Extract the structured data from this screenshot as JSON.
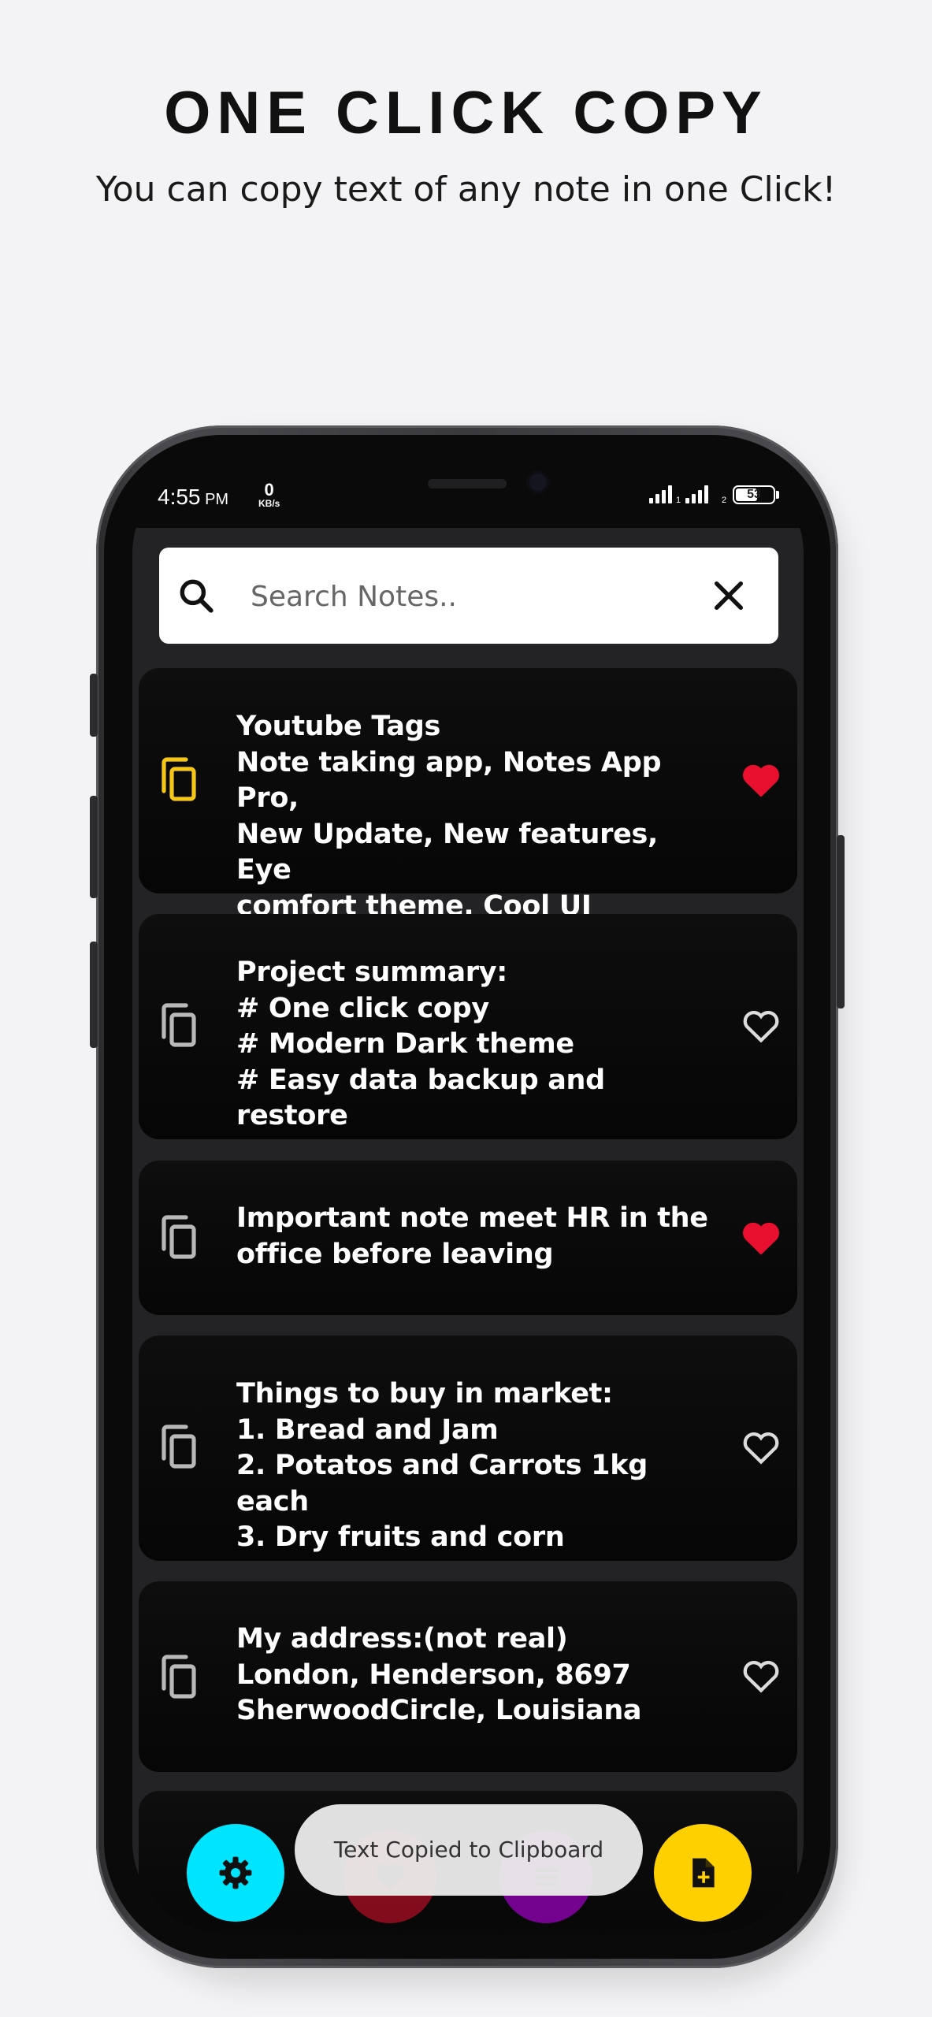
{
  "promo": {
    "title": "ONE CLICK COPY",
    "subtitle": "You can copy text of any note in one Click!"
  },
  "status_bar": {
    "time": "4:55",
    "ampm": "PM",
    "net_speed": "0",
    "net_unit": "KB/s",
    "sim1": "1",
    "sim2": "2",
    "battery": "53"
  },
  "search": {
    "placeholder": "Search Notes..",
    "value": ""
  },
  "notes": [
    {
      "text": "Youtube Tags\nNote taking app, Notes App Pro,\nNew Update, New features, Eye\ncomfort theme, Cool UI",
      "favorite": true,
      "copied": true
    },
    {
      "text": "Project summary:\n# One click copy\n# Modern Dark theme\n# Easy data backup and restore",
      "favorite": false,
      "copied": false
    },
    {
      "text": "Important note meet HR in the\noffice before leaving",
      "favorite": true,
      "copied": false
    },
    {
      "text": "Things to buy in market:\n1. Bread and Jam\n2. Potatos and Carrots 1kg each\n3. Dry fruits and corn",
      "favorite": false,
      "copied": false
    },
    {
      "text": "My address:(not real)\nLondon, Henderson, 8697\nSherwoodCircle, Louisiana",
      "favorite": false,
      "copied": false
    }
  ],
  "toast": "Text Copied to Clipboard",
  "colors": {
    "copied_icon": "#f5c518",
    "copy_icon": "#b8b8b8",
    "favorite": "#e8102e",
    "settings_fab": "#00e5ff",
    "favorites_fab": "#e8102e",
    "list_fab": "#cc00ff",
    "add_fab": "#ffd000"
  },
  "icons": {
    "settings_fab": "gear-icon",
    "favorites_fab": "heart-icon",
    "list_fab": "list-icon",
    "add_fab": "add-note-icon"
  }
}
